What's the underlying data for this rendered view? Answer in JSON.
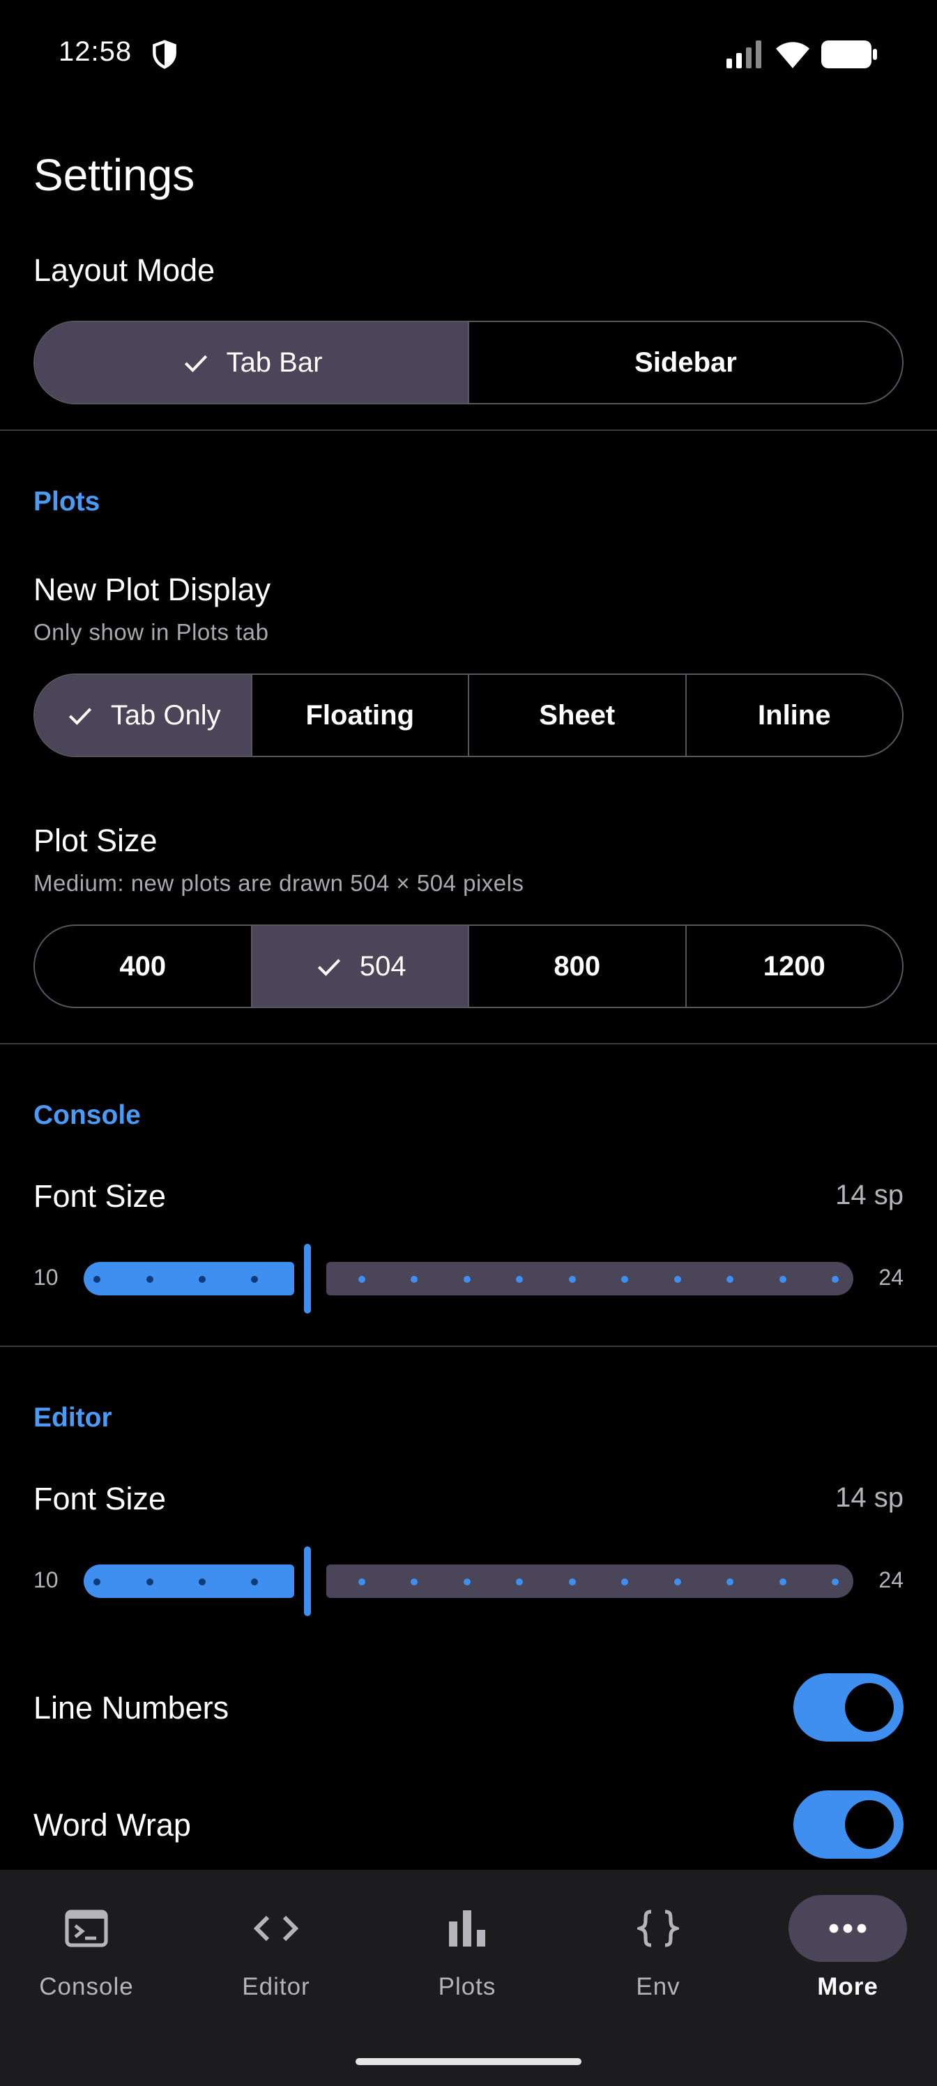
{
  "status_bar": {
    "time": "12:58"
  },
  "title": "Settings",
  "layout_mode": {
    "label": "Layout Mode",
    "options": [
      "Tab Bar",
      "Sidebar"
    ],
    "selected": "Tab Bar"
  },
  "plots": {
    "header": "Plots",
    "new_plot_display": {
      "label": "New Plot Display",
      "description": "Only show in Plots tab",
      "options": [
        "Tab Only",
        "Floating",
        "Sheet",
        "Inline"
      ],
      "selected": "Tab Only"
    },
    "plot_size": {
      "label": "Plot Size",
      "description": "Medium: new plots are drawn 504 × 504 pixels",
      "options": [
        "400",
        "504",
        "800",
        "1200"
      ],
      "selected": "504"
    }
  },
  "console": {
    "header": "Console",
    "font_size": {
      "label": "Font Size",
      "value_text": "14 sp",
      "min": "10",
      "max": "24",
      "value": 14
    }
  },
  "editor": {
    "header": "Editor",
    "font_size": {
      "label": "Font Size",
      "value_text": "14 sp",
      "min": "10",
      "max": "24",
      "value": 14
    },
    "line_numbers": {
      "label": "Line Numbers",
      "on": true
    },
    "word_wrap": {
      "label": "Word Wrap",
      "on": true
    }
  },
  "bottom_nav": {
    "items": [
      {
        "label": "Console",
        "icon": "terminal-icon"
      },
      {
        "label": "Editor",
        "icon": "code-icon"
      },
      {
        "label": "Plots",
        "icon": "bar-chart-icon"
      },
      {
        "label": "Env",
        "icon": "braces-icon"
      },
      {
        "label": "More",
        "icon": "more-horiz-icon",
        "active": true
      }
    ]
  },
  "colors": {
    "accent": "#3f8ff0",
    "selected_segment": "#4a4558",
    "background": "#000000",
    "nav_background": "#1c1c1f"
  }
}
